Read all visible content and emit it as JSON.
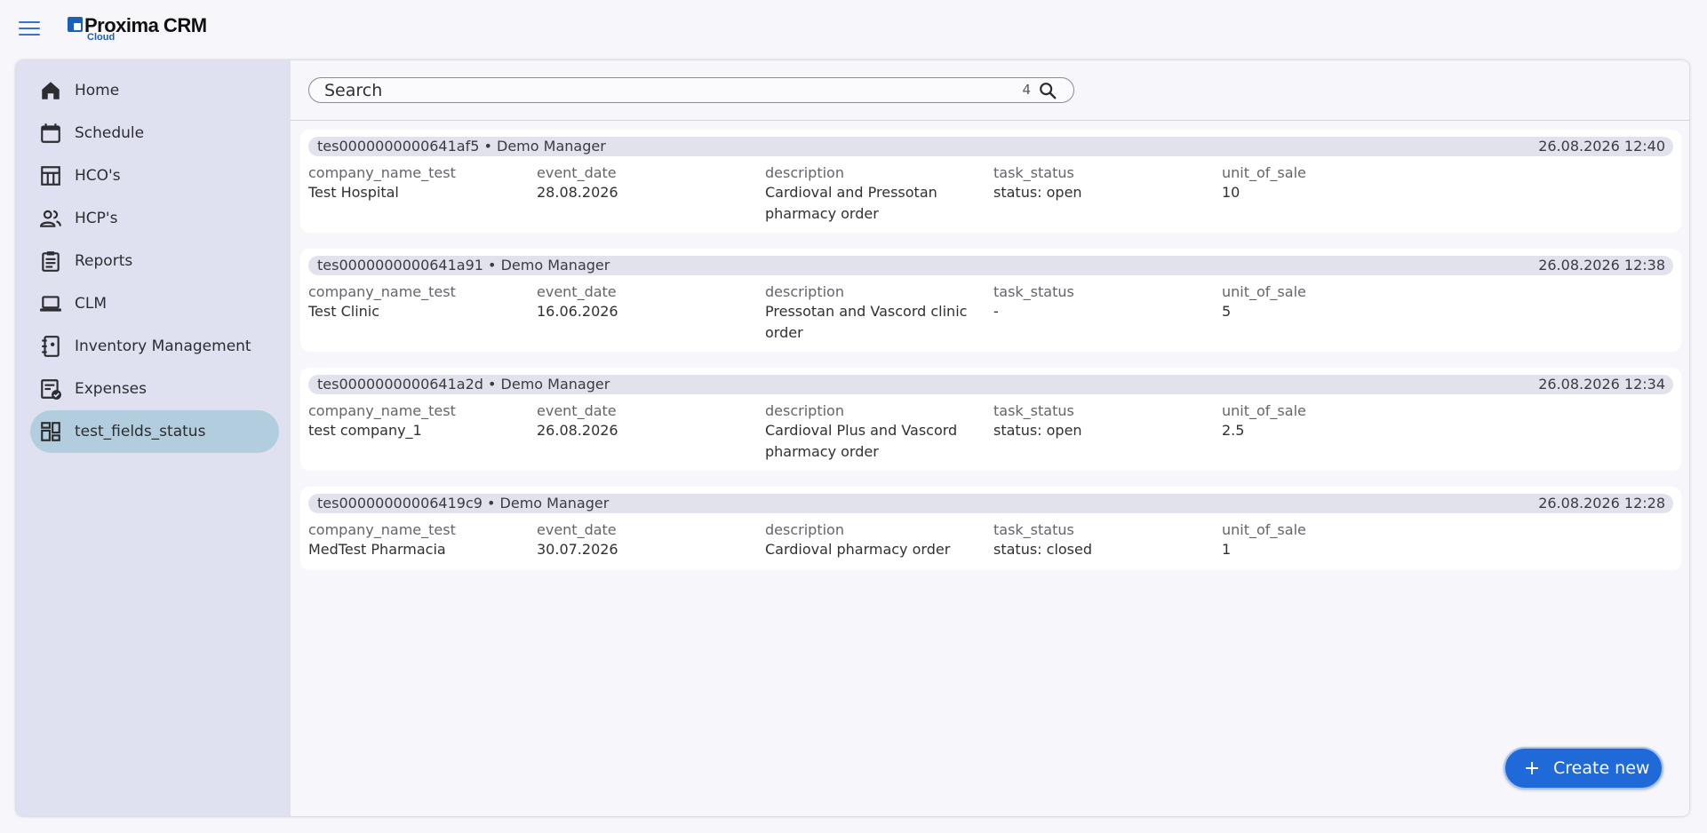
{
  "app": {
    "brand": "Proxima CRM",
    "brand_sub": "Cloud"
  },
  "sidebar": {
    "items": [
      {
        "label": "Home",
        "icon": "home-icon"
      },
      {
        "label": "Schedule",
        "icon": "calendar-icon"
      },
      {
        "label": "HCO's",
        "icon": "building-icon"
      },
      {
        "label": "HCP's",
        "icon": "people-icon"
      },
      {
        "label": "Reports",
        "icon": "clipboard-icon"
      },
      {
        "label": "CLM",
        "icon": "laptop-icon"
      },
      {
        "label": "Inventory Management",
        "icon": "notebook-icon"
      },
      {
        "label": "Expenses",
        "icon": "receipt-check-icon"
      },
      {
        "label": "test_fields_status",
        "icon": "dashboard-icon",
        "active": true
      }
    ]
  },
  "search": {
    "placeholder": "Search",
    "count": "4"
  },
  "columns": [
    "company_name_test",
    "event_date",
    "description",
    "task_status",
    "unit_of_sale"
  ],
  "records": [
    {
      "title": "tes0000000000641af5 • Demo Manager",
      "date": "26.08.2026 12:40",
      "values": [
        "Test Hospital",
        "28.08.2026",
        "Cardioval and Pressotan pharmacy order",
        "status: open",
        "10"
      ]
    },
    {
      "title": "tes0000000000641a91 • Demo Manager",
      "date": "26.08.2026 12:38",
      "values": [
        "Test Clinic",
        "16.06.2026",
        "Pressotan and Vascord clinic order",
        "-",
        "5"
      ]
    },
    {
      "title": "tes0000000000641a2d • Demo Manager",
      "date": "26.08.2026 12:34",
      "values": [
        "test company_1",
        "26.08.2026",
        "Cardioval Plus and Vascord pharmacy order",
        "status: open",
        "2.5"
      ]
    },
    {
      "title": "tes00000000006419c9 • Demo Manager",
      "date": "26.08.2026 12:28",
      "values": [
        "MedTest Pharmacia",
        "30.07.2026",
        "Cardioval pharmacy order",
        "status: closed",
        "1"
      ]
    }
  ],
  "fab": {
    "label": "Create new",
    "icon": "plus-icon"
  },
  "colors": {
    "accent": "#2069d8",
    "sidebar_bg": "#dfe1f1",
    "active_item": "#b2cede"
  }
}
